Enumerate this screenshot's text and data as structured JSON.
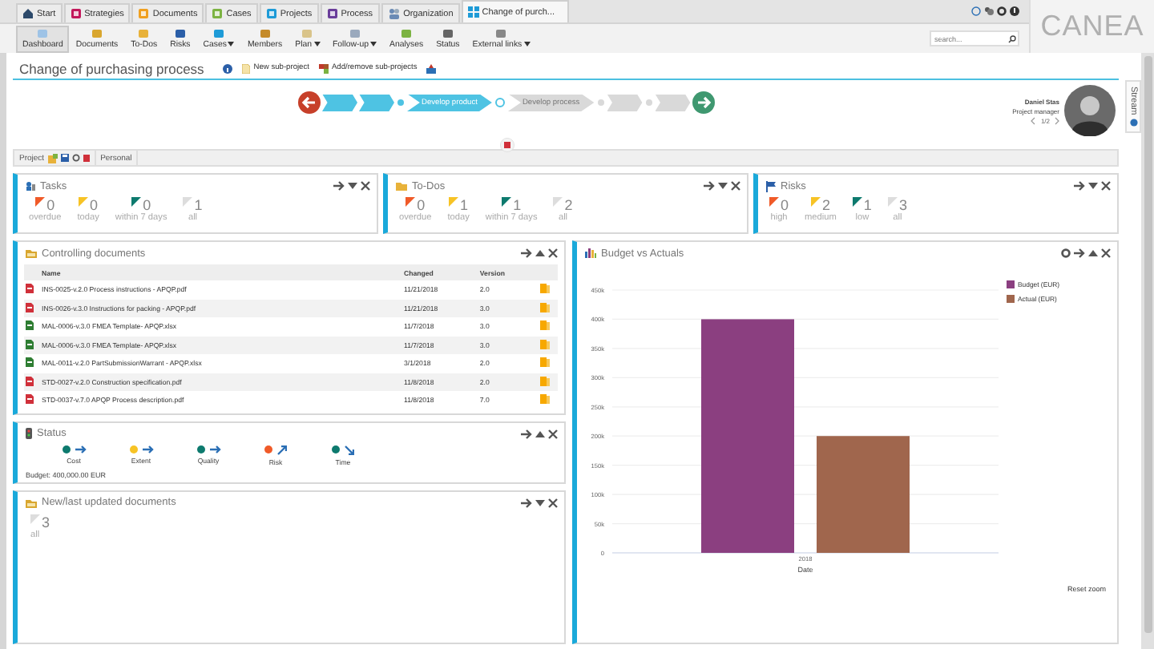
{
  "tabs": [
    {
      "label": "Start",
      "selected": false
    },
    {
      "label": "Strategies",
      "selected": false
    },
    {
      "label": "Documents",
      "selected": false
    },
    {
      "label": "Cases",
      "selected": false
    },
    {
      "label": "Projects",
      "selected": false
    },
    {
      "label": "Process",
      "selected": false
    },
    {
      "label": "Organization",
      "selected": false
    },
    {
      "label": "Change of purch...",
      "selected": true
    }
  ],
  "toolbar": [
    {
      "label": "Dashboard",
      "menu": false,
      "selected": true
    },
    {
      "label": "Documents",
      "menu": false,
      "selected": false
    },
    {
      "label": "To-Dos",
      "menu": false,
      "selected": false
    },
    {
      "label": "Risks",
      "menu": false,
      "selected": false
    },
    {
      "label": "Cases",
      "menu": true,
      "selected": false
    },
    {
      "label": "Members",
      "menu": false,
      "selected": false
    },
    {
      "label": "Plan",
      "menu": true,
      "selected": false
    },
    {
      "label": "Follow-up",
      "menu": true,
      "selected": false
    },
    {
      "label": "Analyses",
      "menu": false,
      "selected": false
    },
    {
      "label": "Status",
      "menu": false,
      "selected": false
    },
    {
      "label": "External links",
      "menu": true,
      "selected": false
    }
  ],
  "search": {
    "placeholder": "search..."
  },
  "logo": "CANEA",
  "page_title": "Change of purchasing process",
  "title_actions": [
    "New sub-project",
    "Add/remove sub-projects"
  ],
  "steps": [
    {
      "kind": "chevron",
      "done": true
    },
    {
      "kind": "chevron",
      "done": true
    },
    {
      "kind": "dot",
      "done": true
    },
    {
      "kind": "chevron",
      "label": "Develop product",
      "done": true
    },
    {
      "kind": "dot",
      "done": false
    },
    {
      "kind": "chevron",
      "label": "Develop process",
      "done": false
    },
    {
      "kind": "dot",
      "done": false
    },
    {
      "kind": "chevron",
      "done": false
    },
    {
      "kind": "dot",
      "done": false
    },
    {
      "kind": "chevron",
      "done": false
    }
  ],
  "manager": {
    "name": "Daniel Stas",
    "role": "Project manager",
    "pager": "1/2"
  },
  "stream_tab": "Stream",
  "layout_bar": {
    "project": "Project",
    "personal": "Personal"
  },
  "tasks": {
    "title": "Tasks",
    "counters": [
      {
        "value": "0",
        "label": "overdue",
        "color": "#f05a28"
      },
      {
        "value": "0",
        "label": "today",
        "color": "#f7c325"
      },
      {
        "value": "0",
        "label": "within 7 days",
        "color": "#0d7a6e"
      },
      {
        "value": "1",
        "label": "all",
        "color": "#dddddd"
      }
    ]
  },
  "todos": {
    "title": "To-Dos",
    "counters": [
      {
        "value": "0",
        "label": "overdue",
        "color": "#f05a28"
      },
      {
        "value": "1",
        "label": "today",
        "color": "#f7c325"
      },
      {
        "value": "1",
        "label": "within 7 days",
        "color": "#0d7a6e"
      },
      {
        "value": "2",
        "label": "all",
        "color": "#dddddd"
      }
    ]
  },
  "risks": {
    "title": "Risks",
    "counters": [
      {
        "value": "0",
        "label": "high",
        "color": "#f05a28"
      },
      {
        "value": "2",
        "label": "medium",
        "color": "#f7c325"
      },
      {
        "value": "1",
        "label": "low",
        "color": "#0d7a6e"
      },
      {
        "value": "3",
        "label": "all",
        "color": "#dddddd"
      }
    ]
  },
  "documents": {
    "title": "Controlling documents",
    "columns": [
      "Name",
      "Changed",
      "Version"
    ],
    "rows": [
      {
        "kind": "pdf",
        "name": "INS-0025-v.2.0 Process instructions - APQP.pdf",
        "changed": "11/21/2018",
        "version": "2.0"
      },
      {
        "kind": "pdf",
        "name": "INS-0026-v.3.0 Instructions for packing - APQP.pdf",
        "changed": "11/21/2018",
        "version": "3.0"
      },
      {
        "kind": "xlsx",
        "name": "MAL-0006-v.3.0 FMEA Template- APQP.xlsx",
        "changed": "11/7/2018",
        "version": "3.0"
      },
      {
        "kind": "xlsx",
        "name": "MAL-0006-v.3.0 FMEA Template- APQP.xlsx",
        "changed": "11/7/2018",
        "version": "3.0"
      },
      {
        "kind": "xlsx",
        "name": "MAL-0011-v.2.0 PartSubmissionWarrant - APQP.xlsx",
        "changed": "3/1/2018",
        "version": "2.0"
      },
      {
        "kind": "pdf",
        "name": "STD-0027-v.2.0 Construction specification.pdf",
        "changed": "11/8/2018",
        "version": "2.0"
      },
      {
        "kind": "pdf",
        "name": "STD-0037-v.7.0 APQP Process description.pdf",
        "changed": "11/8/2018",
        "version": "7.0"
      }
    ]
  },
  "status": {
    "title": "Status",
    "items": [
      {
        "label": "Cost",
        "color": "#0d7a6e",
        "kind": "steady"
      },
      {
        "label": "Extent",
        "color": "#f7c325",
        "kind": "steady"
      },
      {
        "label": "Quality",
        "color": "#0d7a6e",
        "kind": "steady"
      },
      {
        "label": "Risk",
        "color": "#f05a28",
        "kind": "rising"
      },
      {
        "label": "Time",
        "color": "#0d7a6e",
        "kind": "falling"
      }
    ],
    "budget": "Budget:  400,000.00 EUR"
  },
  "new_documents": {
    "title": "New/last updated documents",
    "value": "3",
    "label": "all"
  },
  "budget_chart": {
    "title": "Budget vs Actuals",
    "reset": "Reset zoom",
    "chart_data": {
      "type": "bar",
      "xlabel": "Date",
      "categories": [
        "2018"
      ],
      "series": [
        {
          "name": "Budget (EUR)",
          "color": "#8b3f80",
          "values": [
            400000
          ]
        },
        {
          "name": "Actual (EUR)",
          "color": "#a0664d",
          "values": [
            200000
          ]
        }
      ],
      "ylim": [
        0,
        450000
      ],
      "grid": true,
      "legend": true,
      "yticks": [
        {
          "value": 0,
          "label": "0"
        },
        {
          "value": 50000,
          "label": "50k"
        },
        {
          "value": 100000,
          "label": "100k"
        },
        {
          "value": 150000,
          "label": "150k"
        },
        {
          "value": 200000,
          "label": "200k"
        },
        {
          "value": 250000,
          "label": "250k"
        },
        {
          "value": 300000,
          "label": "300k"
        },
        {
          "value": 350000,
          "label": "350k"
        },
        {
          "value": 400000,
          "label": "400k"
        },
        {
          "value": 450000,
          "label": "450k"
        }
      ]
    }
  }
}
